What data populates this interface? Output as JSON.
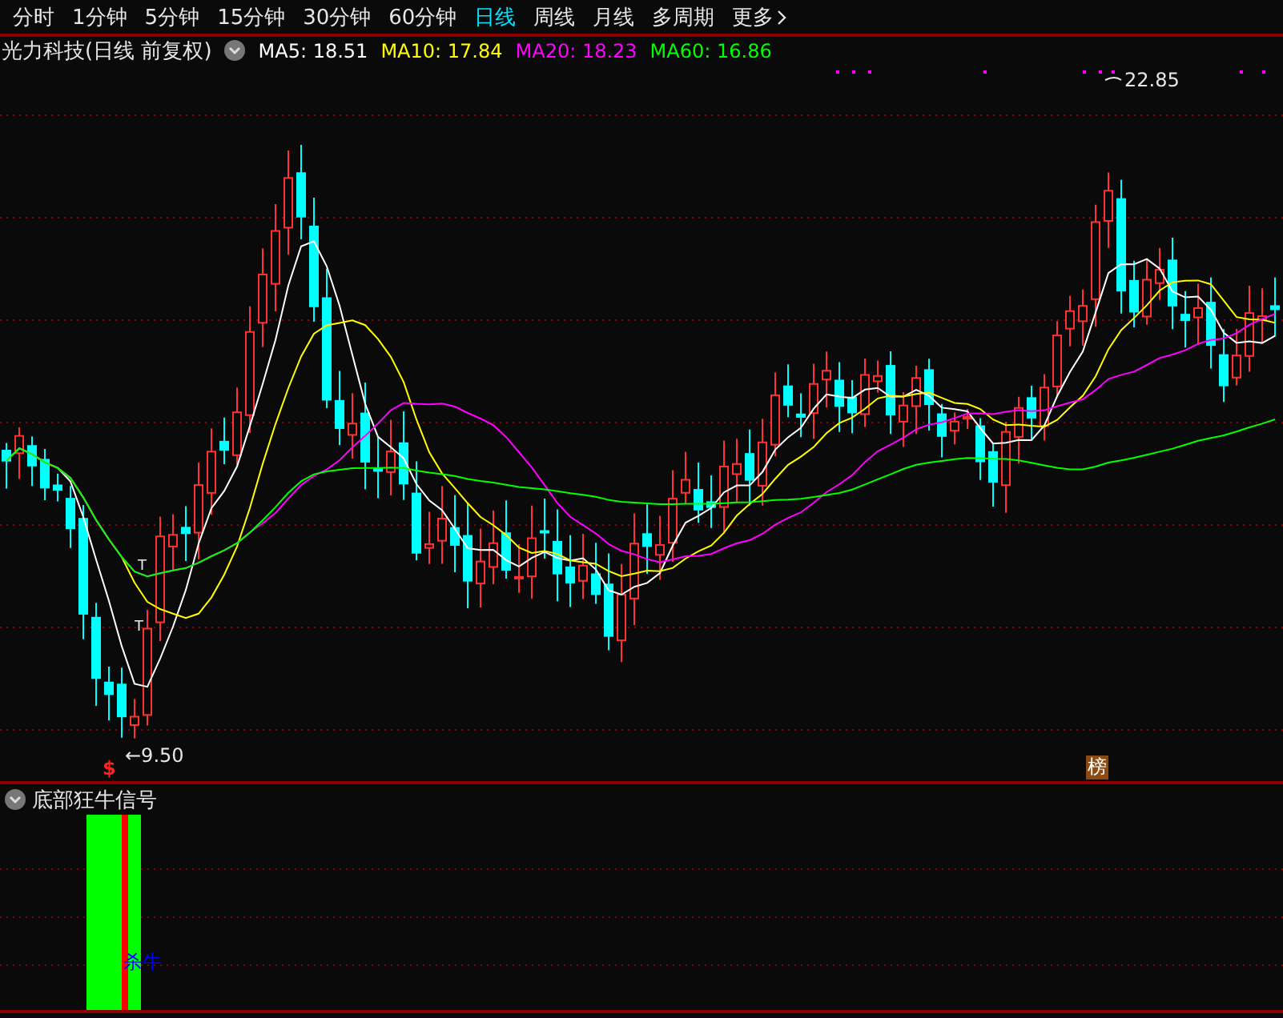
{
  "tabs": [
    {
      "label": "分时",
      "selected": false
    },
    {
      "label": "1分钟",
      "selected": false
    },
    {
      "label": "5分钟",
      "selected": false
    },
    {
      "label": "15分钟",
      "selected": false
    },
    {
      "label": "30分钟",
      "selected": false
    },
    {
      "label": "60分钟",
      "selected": false
    },
    {
      "label": "日线",
      "selected": true
    },
    {
      "label": "周线",
      "selected": false
    },
    {
      "label": "月线",
      "selected": false
    },
    {
      "label": "多周期",
      "selected": false
    },
    {
      "label": "更多",
      "selected": false
    }
  ],
  "legend": {
    "title": "光力科技(日线 前复权)",
    "averages": [
      {
        "label": "MA5: 18.51",
        "color": "#ffffff"
      },
      {
        "label": "MA10: 17.84",
        "color": "#ffff00"
      },
      {
        "label": "MA20: 18.23",
        "color": "#ff00ff"
      },
      {
        "label": "MA60: 16.86",
        "color": "#00ff00"
      }
    ]
  },
  "chart": {
    "low_label": "←9.50",
    "high_label": "22.85",
    "signal_mark": "$",
    "badge": "榜",
    "t_markers": [
      "T",
      "T"
    ]
  },
  "indicator": {
    "title": "底部狂牛信号",
    "signal_text": "杀牛"
  }
}
